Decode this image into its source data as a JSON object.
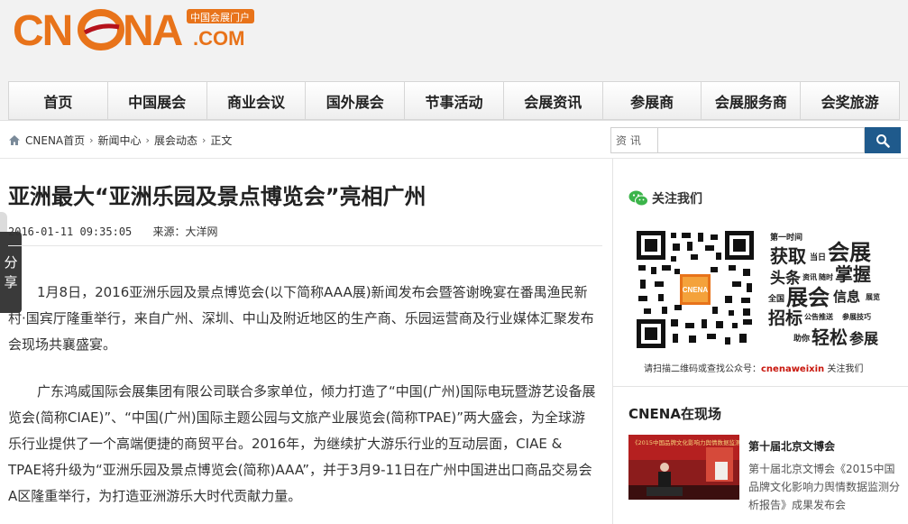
{
  "logo": {
    "text": "CNENA.COM",
    "tagline": "中国会展门户"
  },
  "nav": {
    "items": [
      "首页",
      "中国展会",
      "商业会议",
      "国外展会",
      "节事活动",
      "会展资讯",
      "参展商",
      "会展服务商",
      "会奖旅游"
    ]
  },
  "breadcrumb": {
    "items": [
      "CNENA首页",
      "新闻中心",
      "展会动态",
      "正文"
    ]
  },
  "search": {
    "scope": "资 讯",
    "placeholder": ""
  },
  "share": {
    "label_1": "分",
    "label_2": "享"
  },
  "article": {
    "title": "亚洲最大“亚洲乐园及景点博览会”亮相广州",
    "datetime": "2016-01-11 09:35:05",
    "source": "来源：大洋网",
    "paragraphs": [
      "1月8日，2016亚洲乐园及景点博览会(以下简称AAA展)新闻发布会暨答谢晚宴在番禺渔民新村·国宾厅隆重举行，来自广州、深圳、中山及附近地区的生产商、乐园运营商及行业媒体汇聚发布会现场共襄盛宴。",
      "广东鸿威国际会展集团有限公司联合多家单位，倾力打造了“中国(广州)国际电玩暨游艺设备展览会(简称CIAE)”、“中国(广州)国际主题公园与文旅产业展览会(简称TPAE)”两大盛会，为全球游乐行业提供了一个高端便捷的商贸平台。2016年，为继续扩大游乐行业的互动层面，CIAE & TPAE将升级为“亚洲乐园及景点博览会(简称)AAA”，并于3月9-11日在广州中国进出口商品交易会A区隆重举行，为打造亚洲游乐大时代贡献力量。"
    ]
  },
  "sidebar": {
    "follow_title": "关注我们",
    "promo": {
      "t1": "第一时间",
      "t2": "获取",
      "t3": "当日",
      "t4": "会展",
      "t5": "头条",
      "t6": "资讯",
      "t7": "随时",
      "t8": "掌握",
      "t9": "全国",
      "t10": "展会",
      "t11": "信息",
      "t12": "展览",
      "t13": "招标",
      "t14": "公告推送",
      "t15": "参展技巧",
      "t16": "助你",
      "t17": "轻松",
      "t18": "参展",
      "qr_badge": "CNENA"
    },
    "follow_tip_prefix": "请扫描二维码或查找公众号：",
    "follow_tip_account": "cnenaweixin",
    "follow_tip_suffix": "关注我们",
    "onsite_title": "CNENA在现场",
    "news": {
      "title": "第十届北京文博会",
      "desc": "第十届北京文博会《2015中国品牌文化影响力舆情数据监测分析报告》成果发布会",
      "thumb_text": "《2015中国品牌文化影响力舆情数据监测分析报告》"
    }
  },
  "colors": {
    "brand_orange": "#e8731a",
    "search_blue": "#1f5a8c",
    "accent_red": "#c8160c"
  }
}
